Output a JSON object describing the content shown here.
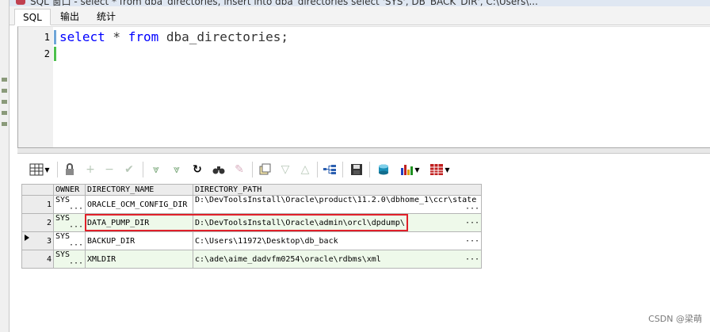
{
  "window": {
    "title": "SQL 窗口 - select * from dba_directories, insert into dba_directories select 'SYS', DB_BACK_DIR', C:\\Users\\..."
  },
  "tabs": [
    {
      "label": "SQL",
      "active": true
    },
    {
      "label": "输出",
      "active": false
    },
    {
      "label": "统计",
      "active": false
    }
  ],
  "editor": {
    "lines": [
      {
        "number": "1",
        "keyword1": "select",
        "rest1": " * ",
        "keyword2": "from",
        "rest2": " dba_directories;"
      },
      {
        "number": "2"
      }
    ]
  },
  "toolbar": {
    "icons": [
      "grid-view-icon",
      "lock-icon",
      "add-row-icon",
      "delete-row-icon",
      "post-icon",
      "fetch-next-icon",
      "fetch-last-icon",
      "refresh-icon",
      "query-by-example-icon",
      "clear-icon",
      "single-record-icon",
      "next-icon",
      "previous-icon",
      "tree-icon",
      "save-icon",
      "export-icon",
      "chart-icon",
      "table-icon"
    ]
  },
  "grid": {
    "columns": [
      "OWNER",
      "DIRECTORY_NAME",
      "DIRECTORY_PATH"
    ],
    "rows": [
      {
        "num": "1",
        "owner": "SYS",
        "name": "ORACLE_OCM_CONFIG_DIR",
        "path": "D:\\DevToolsInstall\\Oracle\\product\\11.2.0\\dbhome_1\\ccr\\state",
        "dots": "···"
      },
      {
        "num": "2",
        "owner": "SYS",
        "name": "DATA_PUMP_DIR",
        "path": "D:\\DevToolsInstall\\Oracle\\admin\\orcl\\dpdump\\",
        "dots": "···"
      },
      {
        "num": "3",
        "owner": "SYS",
        "name": "BACKUP_DIR",
        "path": "C:\\Users\\11972\\Desktop\\db_back",
        "dots": "···"
      },
      {
        "num": "4",
        "owner": "SYS",
        "name": "XMLDIR",
        "path": "c:\\ade\\aime_dadvfm0254\\oracle\\rdbms\\xml",
        "dots": "···"
      }
    ],
    "selected_row": "3"
  },
  "watermark": "CSDN @梁萌",
  "colors": {
    "keyword": "#0000ff",
    "highlight": "#e0202a"
  }
}
